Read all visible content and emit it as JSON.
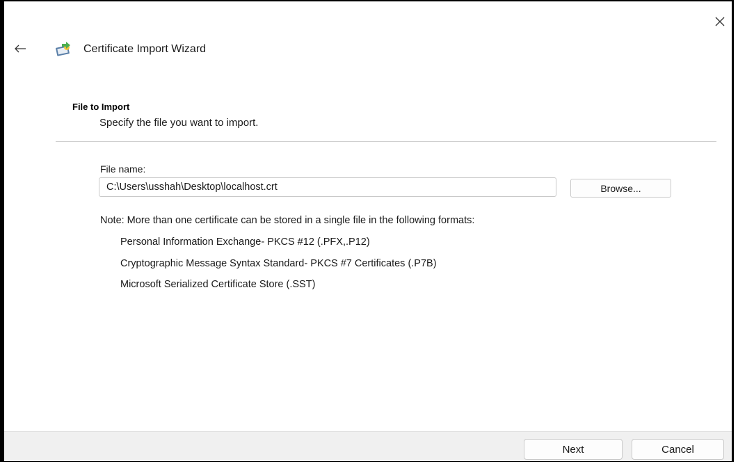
{
  "window": {
    "title": "Certificate Import Wizard",
    "close_icon": "close-icon",
    "back_icon": "back-arrow-icon",
    "wizard_icon": "certificate-import-icon"
  },
  "page": {
    "section_title": "File to Import",
    "section_description": "Specify the file you want to import."
  },
  "file": {
    "label": "File name:",
    "value": "C:\\Users\\usshah\\Desktop\\localhost.crt",
    "browse_label": "Browse..."
  },
  "note": {
    "text": "Note:  More than one certificate can be stored in a single file in the following formats:",
    "formats": [
      "Personal Information Exchange- PKCS #12 (.PFX,.P12)",
      "Cryptographic Message Syntax Standard- PKCS #7 Certificates (.P7B)",
      "Microsoft Serialized Certificate Store (.SST)"
    ]
  },
  "footer": {
    "next_label": "Next",
    "cancel_label": "Cancel"
  }
}
